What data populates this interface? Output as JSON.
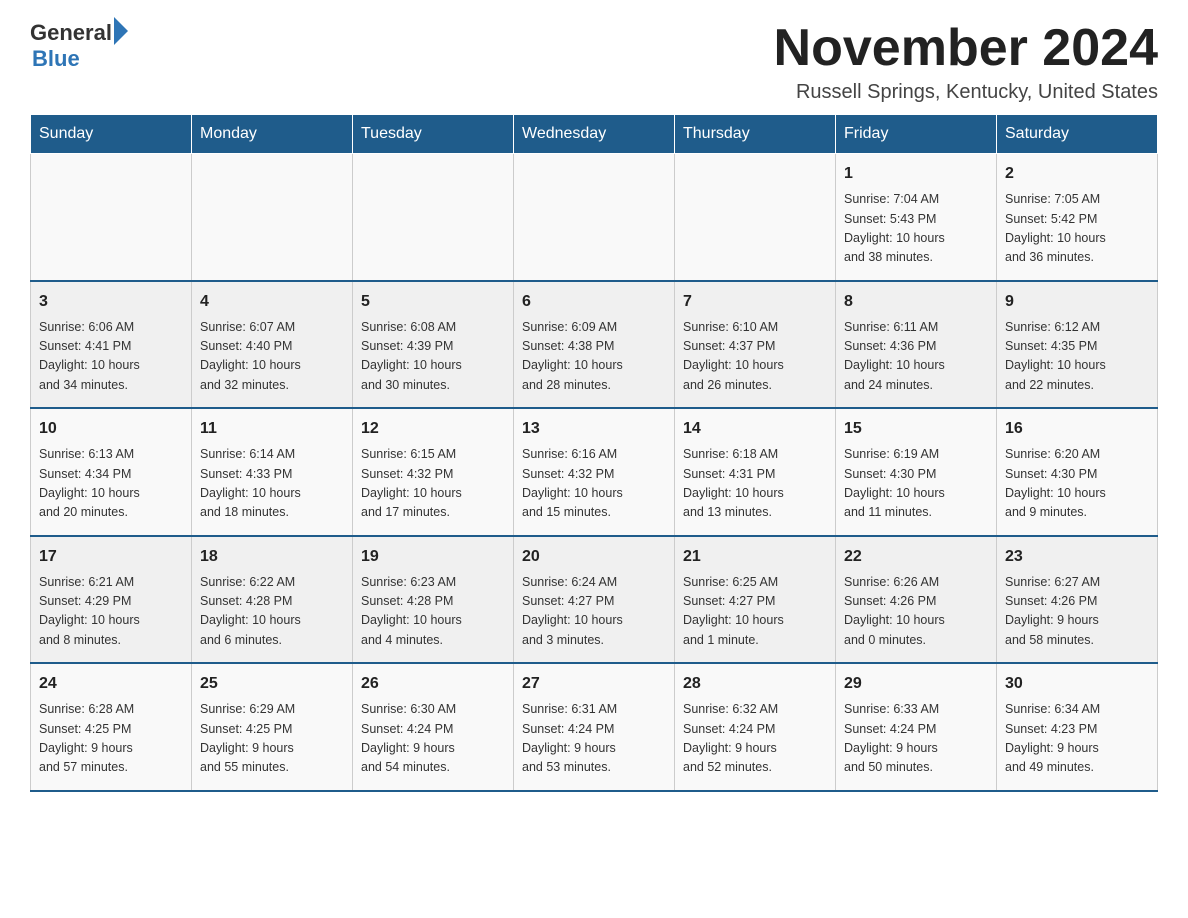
{
  "header": {
    "logo_general": "General",
    "logo_blue": "Blue",
    "title": "November 2024",
    "subtitle": "Russell Springs, Kentucky, United States"
  },
  "days_of_week": [
    "Sunday",
    "Monday",
    "Tuesday",
    "Wednesday",
    "Thursday",
    "Friday",
    "Saturday"
  ],
  "weeks": [
    [
      {
        "day": "",
        "info": ""
      },
      {
        "day": "",
        "info": ""
      },
      {
        "day": "",
        "info": ""
      },
      {
        "day": "",
        "info": ""
      },
      {
        "day": "",
        "info": ""
      },
      {
        "day": "1",
        "info": "Sunrise: 7:04 AM\nSunset: 5:43 PM\nDaylight: 10 hours\nand 38 minutes."
      },
      {
        "day": "2",
        "info": "Sunrise: 7:05 AM\nSunset: 5:42 PM\nDaylight: 10 hours\nand 36 minutes."
      }
    ],
    [
      {
        "day": "3",
        "info": "Sunrise: 6:06 AM\nSunset: 4:41 PM\nDaylight: 10 hours\nand 34 minutes."
      },
      {
        "day": "4",
        "info": "Sunrise: 6:07 AM\nSunset: 4:40 PM\nDaylight: 10 hours\nand 32 minutes."
      },
      {
        "day": "5",
        "info": "Sunrise: 6:08 AM\nSunset: 4:39 PM\nDaylight: 10 hours\nand 30 minutes."
      },
      {
        "day": "6",
        "info": "Sunrise: 6:09 AM\nSunset: 4:38 PM\nDaylight: 10 hours\nand 28 minutes."
      },
      {
        "day": "7",
        "info": "Sunrise: 6:10 AM\nSunset: 4:37 PM\nDaylight: 10 hours\nand 26 minutes."
      },
      {
        "day": "8",
        "info": "Sunrise: 6:11 AM\nSunset: 4:36 PM\nDaylight: 10 hours\nand 24 minutes."
      },
      {
        "day": "9",
        "info": "Sunrise: 6:12 AM\nSunset: 4:35 PM\nDaylight: 10 hours\nand 22 minutes."
      }
    ],
    [
      {
        "day": "10",
        "info": "Sunrise: 6:13 AM\nSunset: 4:34 PM\nDaylight: 10 hours\nand 20 minutes."
      },
      {
        "day": "11",
        "info": "Sunrise: 6:14 AM\nSunset: 4:33 PM\nDaylight: 10 hours\nand 18 minutes."
      },
      {
        "day": "12",
        "info": "Sunrise: 6:15 AM\nSunset: 4:32 PM\nDaylight: 10 hours\nand 17 minutes."
      },
      {
        "day": "13",
        "info": "Sunrise: 6:16 AM\nSunset: 4:32 PM\nDaylight: 10 hours\nand 15 minutes."
      },
      {
        "day": "14",
        "info": "Sunrise: 6:18 AM\nSunset: 4:31 PM\nDaylight: 10 hours\nand 13 minutes."
      },
      {
        "day": "15",
        "info": "Sunrise: 6:19 AM\nSunset: 4:30 PM\nDaylight: 10 hours\nand 11 minutes."
      },
      {
        "day": "16",
        "info": "Sunrise: 6:20 AM\nSunset: 4:30 PM\nDaylight: 10 hours\nand 9 minutes."
      }
    ],
    [
      {
        "day": "17",
        "info": "Sunrise: 6:21 AM\nSunset: 4:29 PM\nDaylight: 10 hours\nand 8 minutes."
      },
      {
        "day": "18",
        "info": "Sunrise: 6:22 AM\nSunset: 4:28 PM\nDaylight: 10 hours\nand 6 minutes."
      },
      {
        "day": "19",
        "info": "Sunrise: 6:23 AM\nSunset: 4:28 PM\nDaylight: 10 hours\nand 4 minutes."
      },
      {
        "day": "20",
        "info": "Sunrise: 6:24 AM\nSunset: 4:27 PM\nDaylight: 10 hours\nand 3 minutes."
      },
      {
        "day": "21",
        "info": "Sunrise: 6:25 AM\nSunset: 4:27 PM\nDaylight: 10 hours\nand 1 minute."
      },
      {
        "day": "22",
        "info": "Sunrise: 6:26 AM\nSunset: 4:26 PM\nDaylight: 10 hours\nand 0 minutes."
      },
      {
        "day": "23",
        "info": "Sunrise: 6:27 AM\nSunset: 4:26 PM\nDaylight: 9 hours\nand 58 minutes."
      }
    ],
    [
      {
        "day": "24",
        "info": "Sunrise: 6:28 AM\nSunset: 4:25 PM\nDaylight: 9 hours\nand 57 minutes."
      },
      {
        "day": "25",
        "info": "Sunrise: 6:29 AM\nSunset: 4:25 PM\nDaylight: 9 hours\nand 55 minutes."
      },
      {
        "day": "26",
        "info": "Sunrise: 6:30 AM\nSunset: 4:24 PM\nDaylight: 9 hours\nand 54 minutes."
      },
      {
        "day": "27",
        "info": "Sunrise: 6:31 AM\nSunset: 4:24 PM\nDaylight: 9 hours\nand 53 minutes."
      },
      {
        "day": "28",
        "info": "Sunrise: 6:32 AM\nSunset: 4:24 PM\nDaylight: 9 hours\nand 52 minutes."
      },
      {
        "day": "29",
        "info": "Sunrise: 6:33 AM\nSunset: 4:24 PM\nDaylight: 9 hours\nand 50 minutes."
      },
      {
        "day": "30",
        "info": "Sunrise: 6:34 AM\nSunset: 4:23 PM\nDaylight: 9 hours\nand 49 minutes."
      }
    ]
  ]
}
